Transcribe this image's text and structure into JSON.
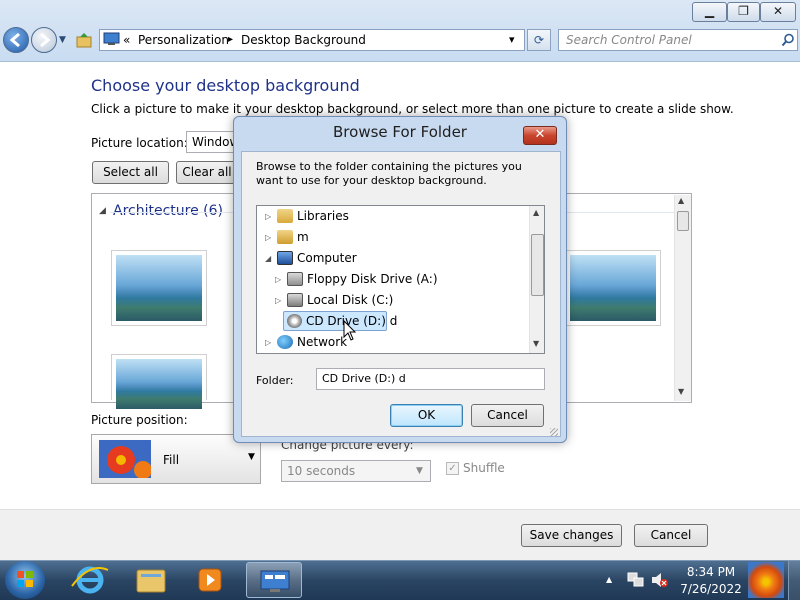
{
  "window": {
    "minimize": "▁",
    "restore": "❐",
    "close": "✕"
  },
  "address": {
    "separator1": "«",
    "crumb1": "Personalization",
    "separator2": "▸",
    "crumb2": "Desktop Background",
    "dropdown": "▾",
    "refresh": "⟳"
  },
  "search": {
    "placeholder": "Search Control Panel"
  },
  "main": {
    "heading": "Choose your desktop background",
    "subheading": "Click a picture to make it your desktop background, or select more than one picture to create a slide show.",
    "picture_location_label": "Picture location:",
    "picture_location_value": "Window",
    "select_all": "Select all",
    "clear_all": "Clear all",
    "group_label": "Architecture (6)",
    "group_toggle": "◢",
    "picture_position_label": "Picture position:",
    "picture_position_value": "Fill",
    "change_picture_label": "Change picture every:",
    "interval_value": "10 seconds",
    "shuffle_label": "Shuffle"
  },
  "dialog": {
    "title": "Browse For Folder",
    "close": "✕",
    "instructions": "Browse to the folder containing the pictures you want to use for your desktop background.",
    "tree": [
      {
        "label": "Libraries",
        "expander": "▷",
        "icon": "libraries-icon"
      },
      {
        "label": "m",
        "expander": "▷",
        "icon": "user-folder-icon"
      },
      {
        "label": "Computer",
        "expander": "◢",
        "icon": "computer-icon"
      },
      {
        "label": "Floppy Disk Drive (A:)",
        "expander": "▷",
        "icon": "floppy-drive-icon"
      },
      {
        "label": "Local Disk (C:)",
        "expander": "▷",
        "icon": "local-disk-icon"
      },
      {
        "label": "CD Drive (D:) d",
        "expander": "",
        "icon": "cd-drive-icon",
        "selected": true
      },
      {
        "label": "Network",
        "expander": "▷",
        "icon": "network-icon"
      }
    ],
    "folder_label": "Folder:",
    "folder_value": "CD Drive (D:) d",
    "ok": "OK",
    "cancel": "Cancel"
  },
  "footer": {
    "save": "Save changes",
    "cancel": "Cancel"
  },
  "taskbar": {
    "time": "8:34 PM",
    "date": "7/26/2022",
    "tray_arrow": "▲"
  },
  "colors": {
    "heading": "#1e3287",
    "selection": "#cce8ff",
    "dialog_frame": "#c8daef",
    "close_red": "#c9452d"
  }
}
